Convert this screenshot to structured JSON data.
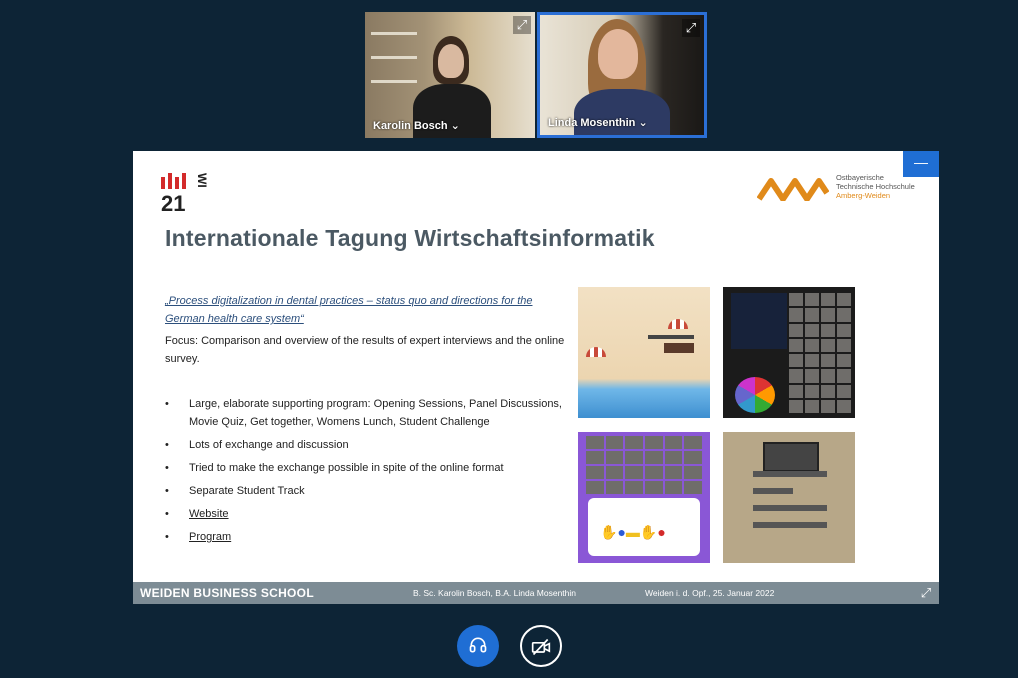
{
  "participants": [
    {
      "name": "Karolin Bosch",
      "caret": "⌄",
      "active": false
    },
    {
      "name": "Linda Mosenthin",
      "caret": "⌄",
      "active": true
    }
  ],
  "slide": {
    "logo_left_number": "21",
    "logo_left_letters": "WI",
    "logo_right_line1": "Ostbayerische",
    "logo_right_line2": "Technische Hochschule",
    "logo_right_line3": "Amberg-Weiden",
    "title": "Internationale Tagung Wirtschaftsinformatik",
    "paper_title": "„Process digitalization in dental practices – status quo and directions for the German health care system“",
    "focus": "Focus: Comparison and overview of the results of expert interviews and the online survey.",
    "bullets": [
      "Large, elaborate supporting program: Opening Sessions, Panel Discussions, Movie Quiz, Get together, Womens Lunch, Student Challenge",
      "Lots of exchange and discussion",
      "Tried to make the exchange possible in spite of the online format",
      "Separate Student Track",
      "Website",
      "Program"
    ],
    "footer_school": "WEIDEN BUSINESS SCHOOL",
    "footer_authors": "B. Sc. Karolin Bosch, B.A. Linda Mosenthin",
    "footer_date": "Weiden i. d. Opf., 25. Januar 2022",
    "minimize_label": "—"
  },
  "colors": {
    "background": "#0d2436",
    "accent_blue": "#1f6ed4",
    "slide_title": "#4b5963",
    "footer": "#7d8c95",
    "logo_red": "#d32a2a",
    "logo_orange": "#e08a1a"
  },
  "icons": {
    "expand": "expand-icon",
    "headset": "headset-icon",
    "camera_off": "camera-off-icon",
    "fullscreen": "fullscreen-icon"
  }
}
